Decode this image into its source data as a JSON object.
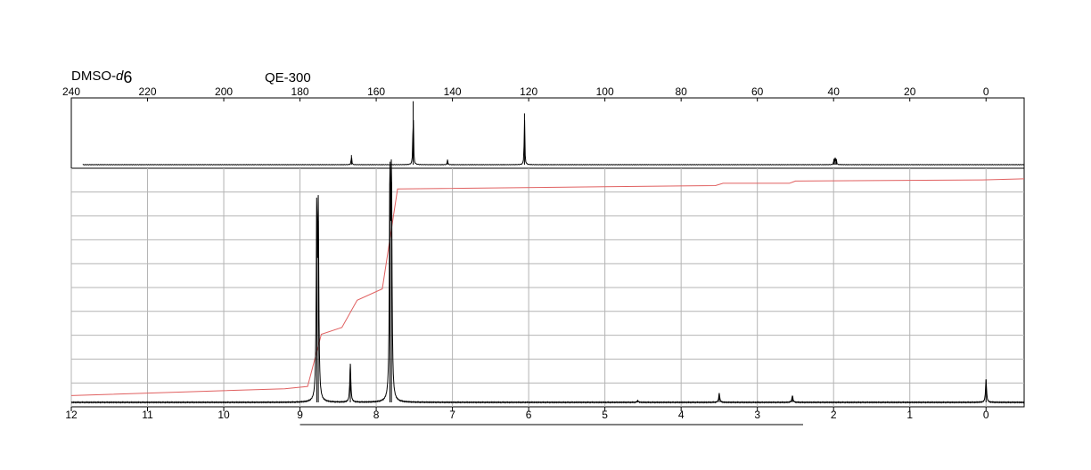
{
  "header": {
    "solvent_prefix": "DMSO-",
    "solvent_d": "d",
    "solvent_sub": "6",
    "instrument": "QE-300"
  },
  "colors": {
    "spectrum": "#000000",
    "integral": "#e06060",
    "grid": "#b4b4b4",
    "frame": "#000000"
  },
  "chart_data": [
    {
      "type": "line",
      "title": "",
      "xlabel": "",
      "ylabel": "",
      "xlim": [
        240,
        -10
      ],
      "ylim": [
        0,
        1
      ],
      "x_reversed": true,
      "grid": false,
      "x_ticks": [
        240,
        220,
        200,
        180,
        160,
        140,
        120,
        100,
        80,
        60,
        40,
        20,
        0
      ],
      "peaks": [
        {
          "x": 166.5,
          "y": 0.15
        },
        {
          "x": 150.3,
          "y": 0.99
        },
        {
          "x": 141.3,
          "y": 0.08
        },
        {
          "x": 121.1,
          "y": 0.8
        },
        {
          "x": 39.9,
          "y": 0.09
        },
        {
          "x": 39.6,
          "y": 0.11
        },
        {
          "x": 39.3,
          "y": 0.09
        }
      ]
    },
    {
      "type": "line",
      "title": "",
      "xlabel": "",
      "ylabel": "",
      "xlim": [
        12,
        -0.5
      ],
      "ylim": [
        0,
        1
      ],
      "x_reversed": true,
      "grid": true,
      "x_ticks": [
        12,
        11,
        10,
        9,
        8,
        7,
        6,
        5,
        4,
        3,
        2,
        1,
        0
      ],
      "peaks": [
        {
          "x": 8.78,
          "y": 0.82
        },
        {
          "x": 8.76,
          "y": 0.8
        },
        {
          "x": 8.34,
          "y": 0.17
        },
        {
          "x": 7.82,
          "y": 0.97
        },
        {
          "x": 7.8,
          "y": 0.97
        },
        {
          "x": 4.57,
          "y": 0.008
        },
        {
          "x": 3.5,
          "y": 0.04
        },
        {
          "x": 2.54,
          "y": 0.03
        },
        {
          "x": 0.0,
          "y": 0.1
        }
      ],
      "integral": [
        {
          "x": 12.0,
          "y": 0.03
        },
        {
          "x": 9.2,
          "y": 0.06
        },
        {
          "x": 8.9,
          "y": 0.07
        },
        {
          "x": 8.72,
          "y": 0.3
        },
        {
          "x": 8.45,
          "y": 0.33
        },
        {
          "x": 8.25,
          "y": 0.45
        },
        {
          "x": 7.92,
          "y": 0.5
        },
        {
          "x": 7.72,
          "y": 0.94
        },
        {
          "x": 5.0,
          "y": 0.95
        },
        {
          "x": 3.55,
          "y": 0.955
        },
        {
          "x": 3.45,
          "y": 0.965
        },
        {
          "x": 2.58,
          "y": 0.965
        },
        {
          "x": 2.5,
          "y": 0.975
        },
        {
          "x": 0.05,
          "y": 0.98
        },
        {
          "x": -0.5,
          "y": 0.985
        }
      ],
      "scale_bar": [
        9.0,
        2.4
      ]
    }
  ]
}
